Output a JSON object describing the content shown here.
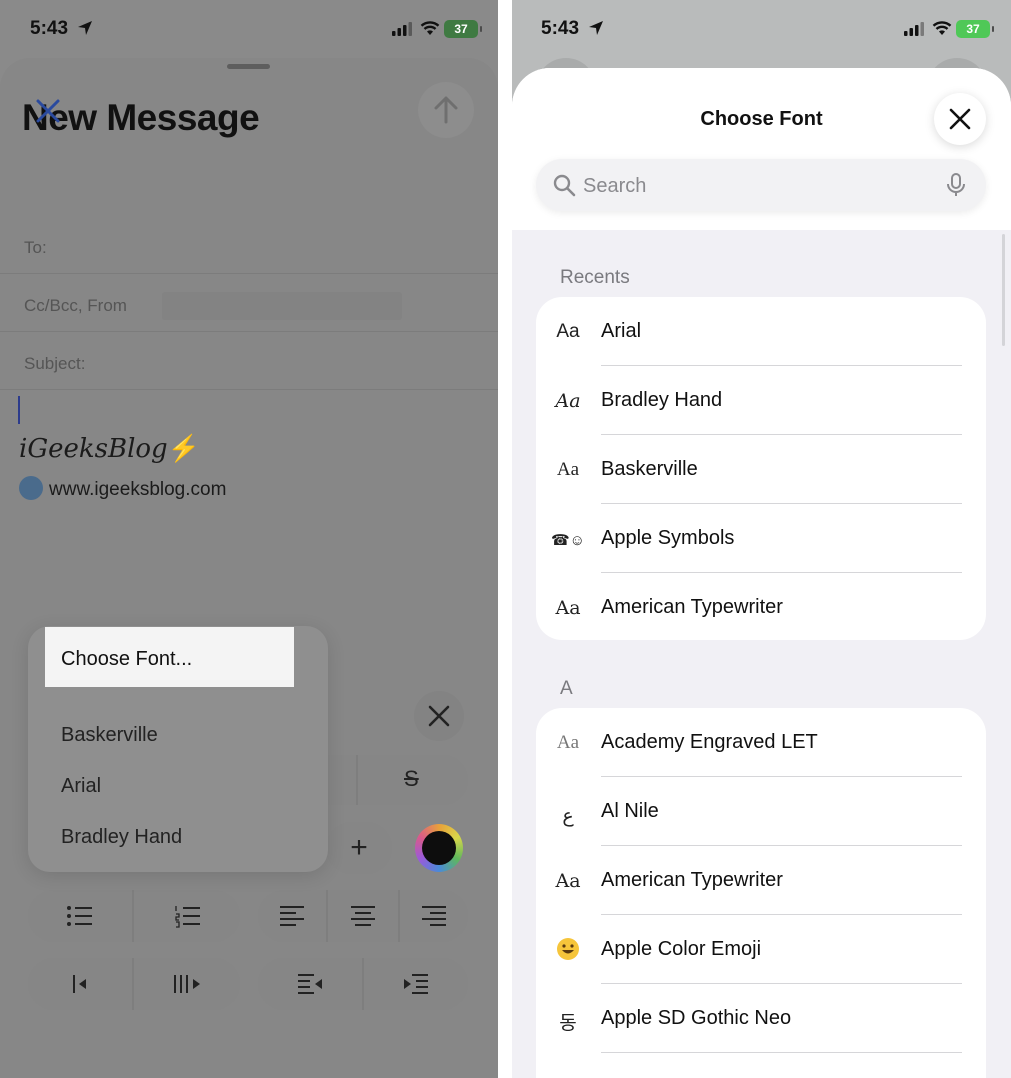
{
  "left": {
    "status": {
      "time": "5:43",
      "battery": "37"
    },
    "compose": {
      "title": "New Message",
      "fields": {
        "to": "To:",
        "cc": "Cc/Bcc, From",
        "subject": "Subject:"
      }
    },
    "signature": {
      "brand": "iGeeksBlog",
      "bolt": "⚡",
      "site": "www.igeeksblog.com"
    },
    "font_menu": {
      "choose_label": "Choose Font...",
      "items": [
        "Baskerville",
        "Arial",
        "Bradley Hand"
      ]
    },
    "toolbar": {
      "strike_glyph": "S",
      "plus_glyph": "+"
    }
  },
  "right": {
    "status": {
      "time": "5:43",
      "battery": "37"
    },
    "picker": {
      "title": "Choose Font",
      "search_placeholder": "Search",
      "recents_header": "Recents",
      "recents": [
        {
          "preview": "Aa",
          "name": "Arial"
        },
        {
          "preview": "Aa",
          "name": "Bradley Hand"
        },
        {
          "preview": "Aa",
          "name": "Baskerville"
        },
        {
          "preview": "☎☺",
          "name": "Apple Symbols"
        },
        {
          "preview": "Aa",
          "name": "American Typewriter"
        }
      ],
      "section_a_header": "A",
      "section_a": [
        {
          "preview": "Aa",
          "name": "Academy Engraved LET"
        },
        {
          "preview": "ع",
          "name": "Al Nile"
        },
        {
          "preview": "Aa",
          "name": "American Typewriter"
        },
        {
          "preview": "😀",
          "name": "Apple Color Emoji"
        },
        {
          "preview": "동",
          "name": "Apple SD Gothic Neo"
        }
      ]
    }
  }
}
